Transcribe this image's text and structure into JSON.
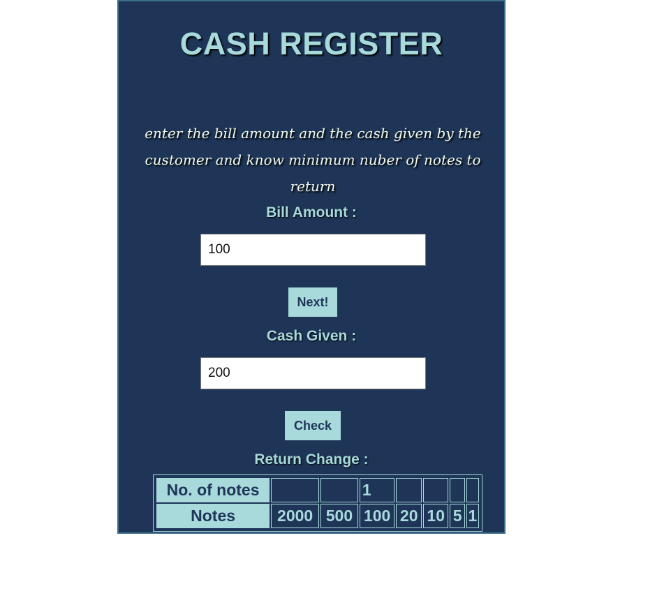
{
  "app": {
    "title": "CASH REGISTER",
    "description": "enter the bill amount and the cash given by the customer and know minimum nuber of notes to return"
  },
  "bill": {
    "label": "Bill Amount :",
    "value": "100"
  },
  "next_button": "Next!",
  "cash": {
    "label": "Cash Given :",
    "value": "200"
  },
  "check_button": "Check",
  "result": {
    "label": "Return Change :",
    "count_header": "No. of notes",
    "notes_header": "Notes",
    "notes": [
      "2000",
      "500",
      "100",
      "20",
      "10",
      "5",
      "1"
    ],
    "counts": [
      "",
      "",
      "1",
      "",
      "",
      "",
      ""
    ]
  },
  "colors": {
    "background": "#1e3557",
    "accent": "#a8dadc",
    "text_light": "#f1faee"
  }
}
